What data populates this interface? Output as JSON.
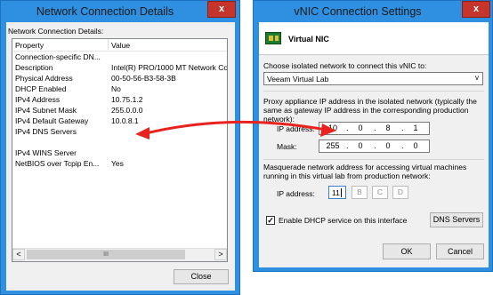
{
  "left_window": {
    "title": "Network Connection Details",
    "close_glyph": "x",
    "group_label": "Network Connection Details:",
    "columns": [
      "Property",
      "Value"
    ],
    "rows": [
      {
        "property": "Connection-specific DN...",
        "value": ""
      },
      {
        "property": "Description",
        "value": "Intel(R) PRO/1000 MT Network Connecti"
      },
      {
        "property": "Physical Address",
        "value": "00-50-56-B3-58-3B"
      },
      {
        "property": "DHCP Enabled",
        "value": "No"
      },
      {
        "property": "IPv4 Address",
        "value": "10.75.1.2"
      },
      {
        "property": "IPv4 Subnet Mask",
        "value": "255.0.0.0"
      },
      {
        "property": "IPv4 Default Gateway",
        "value": "10.0.8.1"
      },
      {
        "property": "IPv4 DNS Servers",
        "value": ""
      },
      {
        "property": "",
        "value": ""
      },
      {
        "property": "IPv4 WINS Server",
        "value": ""
      },
      {
        "property": "NetBIOS over Tcpip En...",
        "value": "Yes"
      }
    ],
    "scroll_left": "<",
    "scroll_right": ">",
    "scroll_thumb": "III",
    "close_button": "Close"
  },
  "right_window": {
    "title": "vNIC Connection Settings",
    "close_glyph": "x",
    "header_title": "Virtual NIC",
    "isolated_label": "Choose isolated network to connect this vNIC to:",
    "isolated_value": "Veeam Virtual Lab",
    "dropdown_arrow": "v",
    "proxy_text": "Proxy appliance IP address in the isolated network (typically the same as gateway IP address in the corresponding production network):",
    "ip_label": "IP address:",
    "ip_octets": [
      "10",
      "0",
      "8",
      "1"
    ],
    "mask_label": "Mask:",
    "mask_octets": [
      "255",
      "0",
      "0",
      "0"
    ],
    "masq_text": "Masquerade network address for accessing virtual machines running in this virtual lab from production network:",
    "masq_ip_label": "IP address:",
    "masq_first_octet": "11",
    "masq_placeholders": [
      "B",
      "C",
      "D"
    ],
    "dhcp_label": "Enable DHCP service on this interface",
    "dhcp_checked": true,
    "dns_button": "DNS Servers",
    "ok_button": "OK",
    "cancel_button": "Cancel"
  },
  "colors": {
    "title_bar": "#2f8fe0",
    "close_button": "#c5352b",
    "arrow": "#e8231f",
    "dialog_bg": "#f0f0f0"
  }
}
